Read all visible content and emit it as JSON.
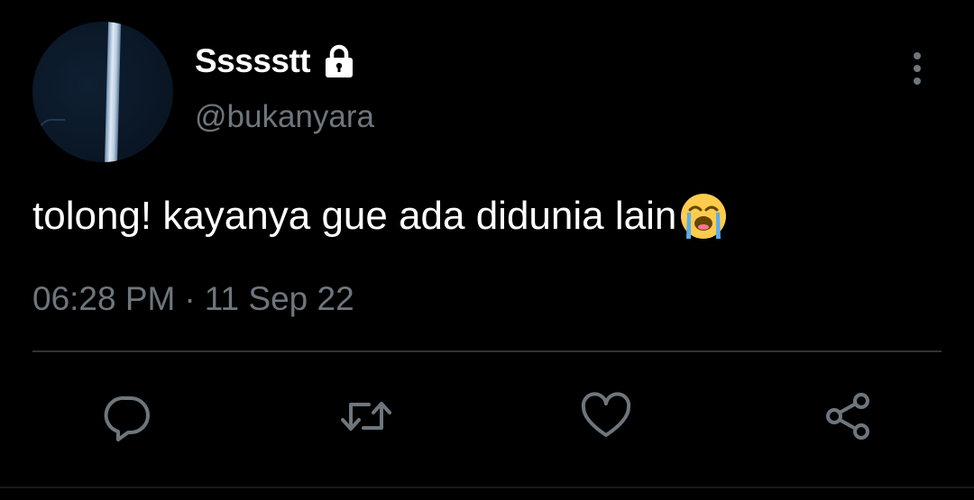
{
  "tweet": {
    "display_name": "Ssssstt",
    "handle": "@bukanyara",
    "text": "tolong! kayanya gue ada didunia lain",
    "emoji_icon": "loudly-crying-face-emoji",
    "time": "06:28 PM",
    "separator": "·",
    "date": "11 Sep 22",
    "protected_icon": "lock-icon"
  },
  "actions": [
    {
      "name": "reply",
      "icon": "reply-bubble-icon"
    },
    {
      "name": "retweet",
      "icon": "retweet-icon"
    },
    {
      "name": "like",
      "icon": "heart-icon"
    },
    {
      "name": "share",
      "icon": "share-icon"
    }
  ],
  "colors": {
    "background": "#000000",
    "primary_text": "#ffffff",
    "secondary_text": "#6e767d",
    "divider": "#2f3336",
    "icon": "#6e767d"
  }
}
